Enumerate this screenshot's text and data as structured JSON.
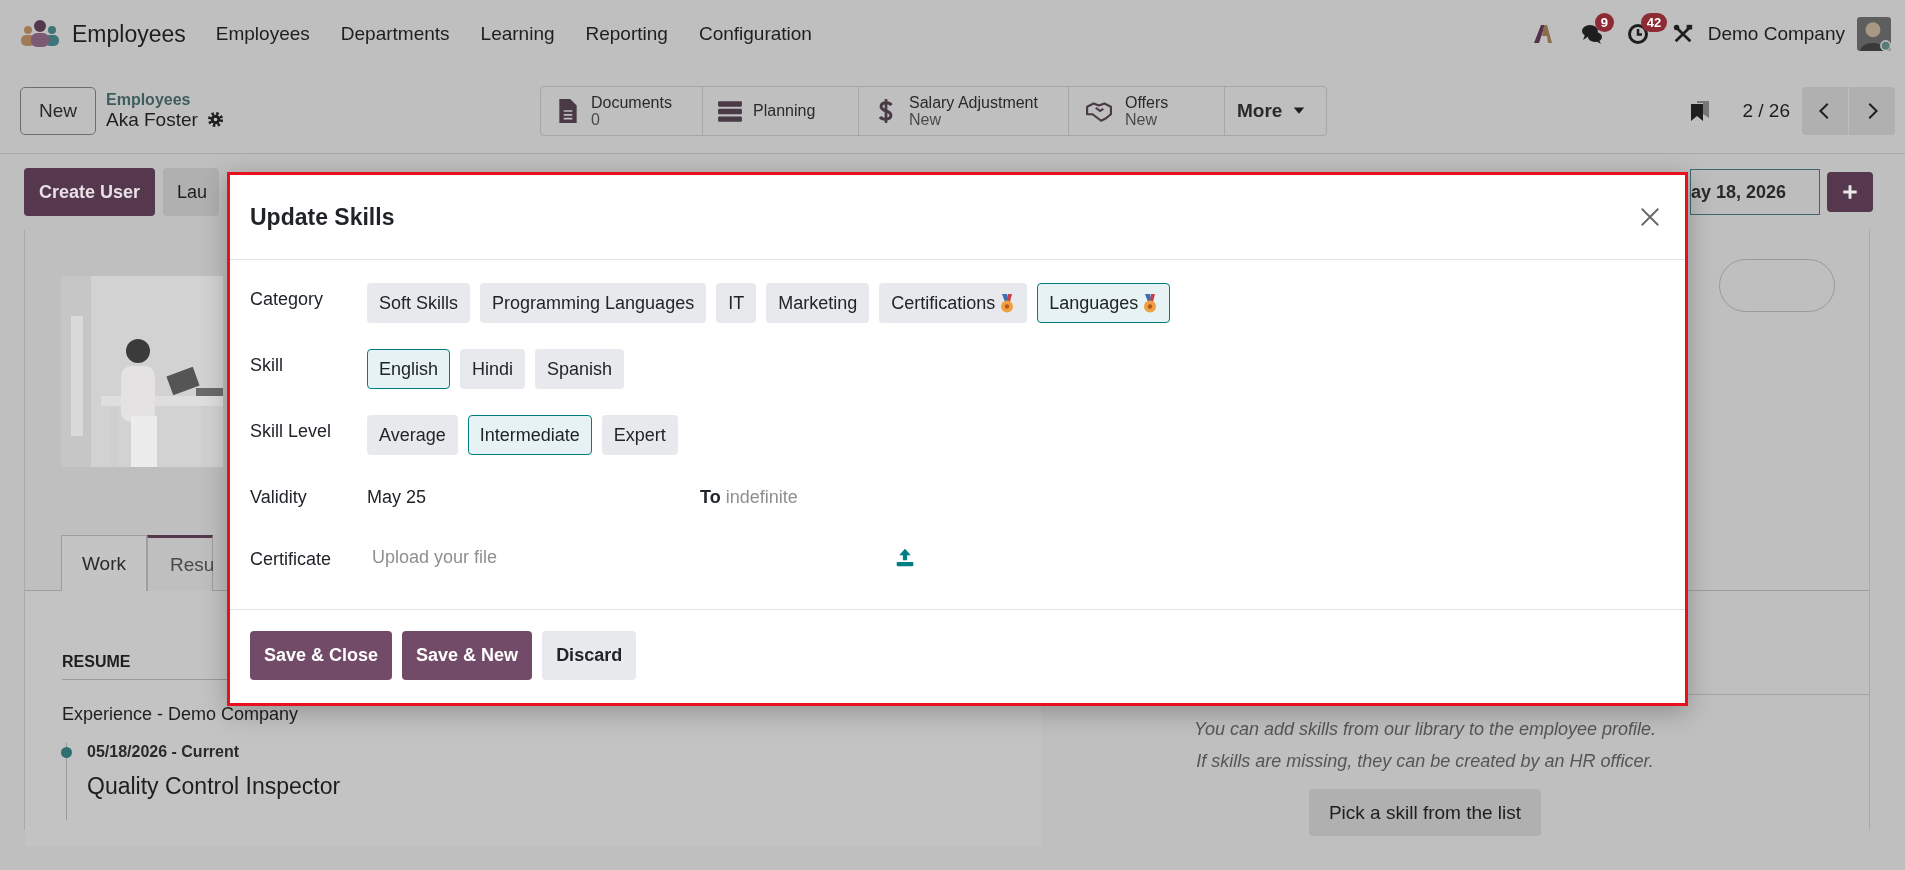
{
  "navbar": {
    "app_name": "Employees",
    "menu": [
      "Employees",
      "Departments",
      "Learning",
      "Reporting",
      "Configuration"
    ],
    "messages_count": "9",
    "activities_count": "42",
    "company": "Demo Company"
  },
  "control_panel": {
    "new_button": "New",
    "breadcrumb": "Employees",
    "record_title": "Aka Foster",
    "smart_buttons": [
      {
        "kind": "documents",
        "label": "Documents",
        "value": "0"
      },
      {
        "kind": "planning",
        "label": "Planning"
      },
      {
        "kind": "salary",
        "label": "Salary Adjustment",
        "value": "New"
      },
      {
        "kind": "offers",
        "label": "Offers",
        "value": "New"
      },
      {
        "kind": "more",
        "label": "More"
      }
    ],
    "pager": "2 / 26"
  },
  "action_bar": {
    "buttons": [
      {
        "label": "Create User",
        "kind": "primary"
      },
      {
        "label": "Lau",
        "kind": "secondary"
      }
    ],
    "date_field": "ay 18, 2026"
  },
  "tabs": [
    {
      "label": "Work",
      "selected": false
    },
    {
      "label": "Resu",
      "selected": true
    }
  ],
  "resume": {
    "heading": "RESUME",
    "group": "Experience - Demo Company",
    "entries": [
      {
        "dates": "05/18/2026 - Current",
        "title": "Quality Control Inspector"
      }
    ]
  },
  "skills_panel": {
    "help": [
      "You can add skills from our library to the employee profile.",
      "If skills are missing, they can be created by an HR officer."
    ],
    "button": "Pick a skill from the list"
  },
  "dialog": {
    "title": "Update Skills",
    "fields": [
      {
        "kind": "choices",
        "label": "Category",
        "options": [
          {
            "label": "Soft Skills",
            "selected": false,
            "medal": false
          },
          {
            "label": "Programming Languages",
            "selected": false,
            "medal": false
          },
          {
            "label": "IT",
            "selected": false,
            "medal": false
          },
          {
            "label": "Marketing",
            "selected": false,
            "medal": false
          },
          {
            "label": "Certifications",
            "selected": false,
            "medal": true
          },
          {
            "label": "Languages",
            "selected": true,
            "medal": true
          }
        ]
      },
      {
        "kind": "choices",
        "label": "Skill",
        "options": [
          {
            "label": "English",
            "selected": true,
            "medal": false
          },
          {
            "label": "Hindi",
            "selected": false,
            "medal": false
          },
          {
            "label": "Spanish",
            "selected": false,
            "medal": false
          }
        ]
      },
      {
        "kind": "choices",
        "label": "Skill Level",
        "options": [
          {
            "label": "Average",
            "selected": false,
            "medal": false
          },
          {
            "label": "Intermediate",
            "selected": true,
            "medal": false
          },
          {
            "label": "Expert",
            "selected": false,
            "medal": false
          }
        ]
      },
      {
        "kind": "date_range",
        "label": "Validity",
        "value": "May 25",
        "to_label": "To",
        "to_placeholder": "indefinite"
      },
      {
        "kind": "file",
        "label": "Certificate",
        "placeholder": "Upload your file"
      }
    ],
    "buttons": [
      {
        "label": "Save & Close",
        "kind": "primary"
      },
      {
        "label": "Save & New",
        "kind": "primary"
      },
      {
        "label": "Discard",
        "kind": "secondary"
      }
    ]
  }
}
